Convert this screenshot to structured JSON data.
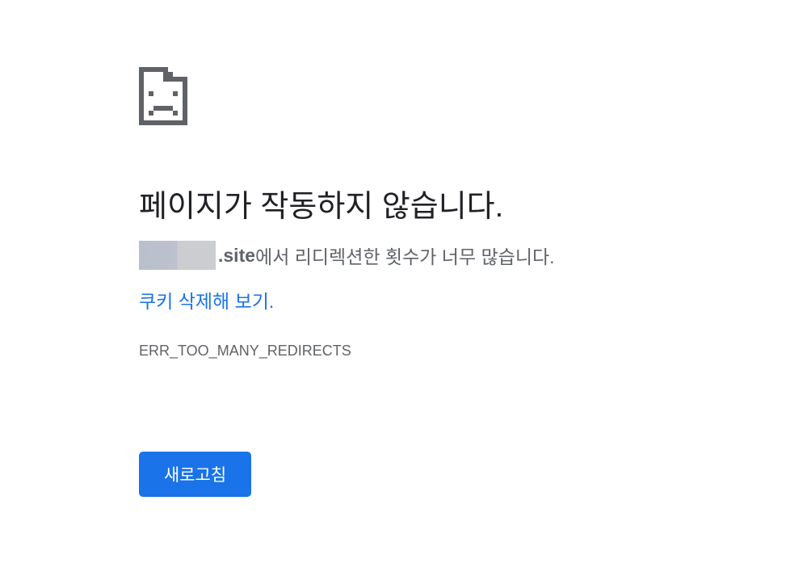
{
  "error_page": {
    "icon": "sad-document-icon",
    "heading": "페이지가 작동하지 않습니다.",
    "message": {
      "site_suffix": ".site",
      "text": "에서 리디렉션한 횟수가 너무 많습니다."
    },
    "suggestion_link": "쿠키 삭제해 보기.",
    "error_code": "ERR_TOO_MANY_REDIRECTS",
    "reload_label": "새로고침"
  },
  "colors": {
    "heading": "#202124",
    "body_text": "#5f6368",
    "link": "#1a73e8",
    "button_bg": "#1a73e8",
    "button_text": "#ffffff",
    "icon": "#5f6368"
  }
}
